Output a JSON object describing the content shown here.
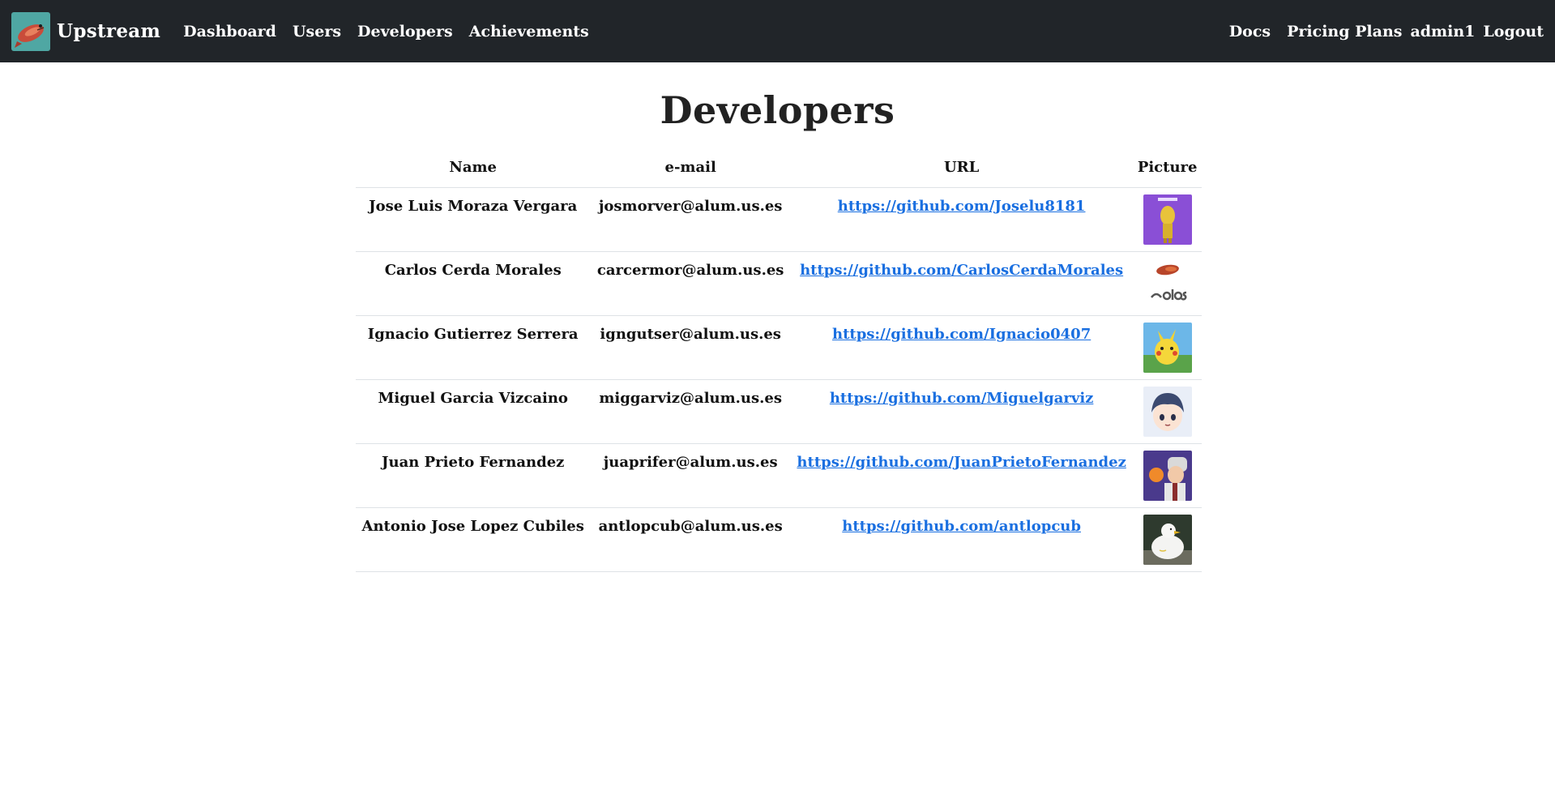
{
  "nav": {
    "brand": "Upstream",
    "left_links": [
      "Dashboard",
      "Users",
      "Developers",
      "Achievements"
    ],
    "docs": "Docs",
    "pricing": "Pricing Plans",
    "user": "admin1",
    "logout": "Logout"
  },
  "page": {
    "title": "Developers",
    "columns": [
      "Name",
      "e-mail",
      "URL",
      "Picture"
    ]
  },
  "developers": [
    {
      "name": "Jose Luis Moraza Vergara",
      "email": "josmorver@alum.us.es",
      "url": "https://github.com/Joselu8181",
      "picture": "banana-costume-avatar"
    },
    {
      "name": "Carlos Cerda Morales",
      "email": "carcermor@alum.us.es",
      "url": "https://github.com/CarlosCerdaMorales",
      "picture": "carlos-logo-avatar"
    },
    {
      "name": "Ignacio Gutierrez Serrera",
      "email": "igngutser@alum.us.es",
      "url": "https://github.com/Ignacio0407",
      "picture": "pikachu-avatar"
    },
    {
      "name": "Miguel Garcia Vizcaino",
      "email": "miggarviz@alum.us.es",
      "url": "https://github.com/Miguelgarviz",
      "picture": "anime-boy-avatar"
    },
    {
      "name": "Juan Prieto Fernandez",
      "email": "juaprifer@alum.us.es",
      "url": "https://github.com/JuanPrietoFernandez",
      "picture": "professor-avatar"
    },
    {
      "name": "Antonio Jose Lopez Cubiles",
      "email": "antlopcub@alum.us.es",
      "url": "https://github.com/antlopcub",
      "picture": "white-bird-avatar"
    }
  ]
}
